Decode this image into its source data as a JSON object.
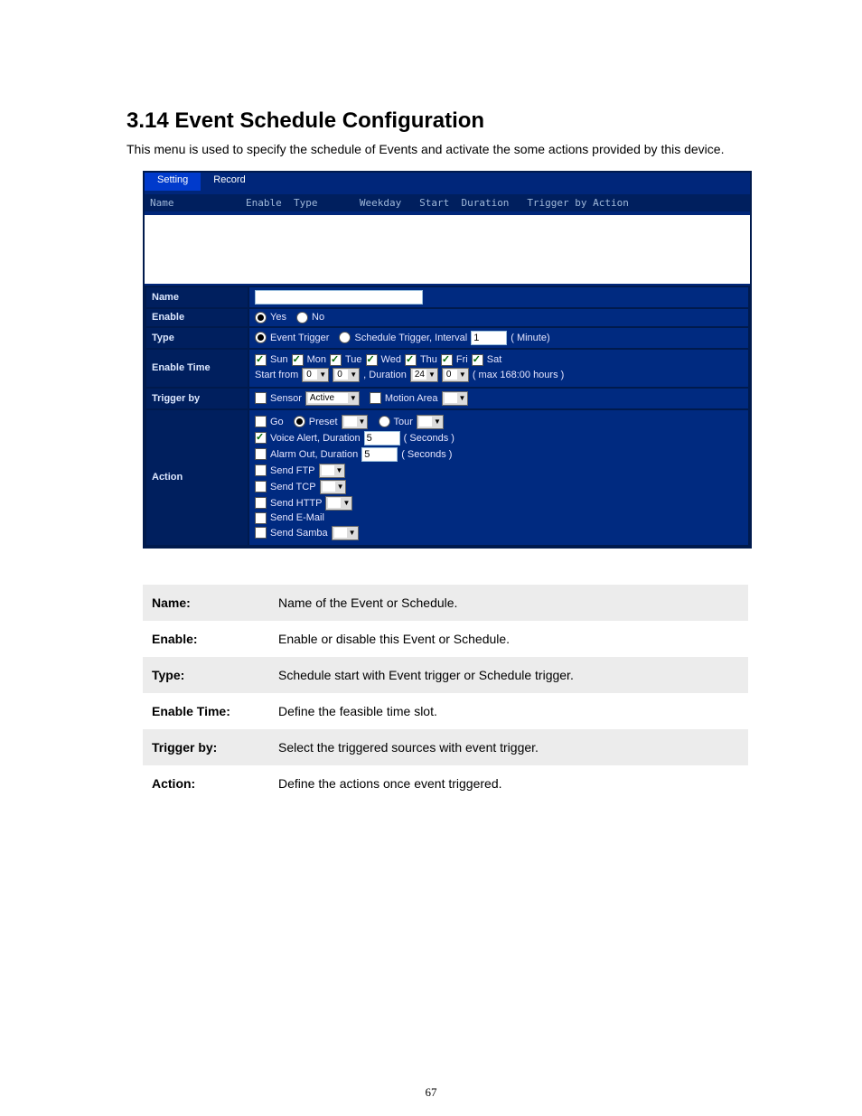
{
  "heading": "3.14 Event Schedule Configuration",
  "intro": "This menu is used to specify the schedule of Events and activate the some actions provided by this device.",
  "page_number": "67",
  "tabs": {
    "setting": "Setting",
    "record": "Record"
  },
  "list_header": {
    "name": "Name",
    "enable": "Enable",
    "type": "Type",
    "weekday": "Weekday",
    "start": "Start",
    "duration": "Duration",
    "trigger": "Trigger by Action"
  },
  "form": {
    "name_label": "Name",
    "name_value": "",
    "enable_label": "Enable",
    "enable_yes": "Yes",
    "enable_no": "No",
    "type_label": "Type",
    "type_event": "Event Trigger",
    "type_sched": "Schedule Trigger, Interval",
    "type_interval": "1",
    "type_unit": "( Minute)",
    "enabletime_label": "Enable Time",
    "days": {
      "sun": "Sun",
      "mon": "Mon",
      "tue": "Tue",
      "wed": "Wed",
      "thu": "Thu",
      "fri": "Fri",
      "sat": "Sat"
    },
    "start_from": "Start from",
    "start_h": "0",
    "start_m": "0",
    "dur_label": ", Duration",
    "dur_h": "24",
    "dur_m": "0",
    "dur_hint": "( max 168:00 hours )",
    "trigger_label": "Trigger by",
    "trigger_sensor": "Sensor",
    "trigger_sensor_val": "Active",
    "trigger_motion": "Motion Area",
    "action_label": "Action",
    "act_go": "Go",
    "act_preset": "Preset",
    "act_tour": "Tour",
    "act_voice": "Voice Alert, Duration",
    "act_voice_val": "5",
    "act_voice_unit": "( Seconds )",
    "act_alarm": "Alarm Out, Duration",
    "act_alarm_val": "5",
    "act_alarm_unit": "( Seconds )",
    "act_ftp": "Send FTP",
    "act_tcp": "Send TCP",
    "act_http": "Send HTTP",
    "act_email": "Send E-Mail",
    "act_samba": "Send Samba"
  },
  "defs": [
    {
      "k": "Name:",
      "v": "Name of the Event or Schedule."
    },
    {
      "k": "Enable:",
      "v": "Enable or disable this Event or Schedule."
    },
    {
      "k": "Type:",
      "v": "Schedule start with Event trigger or Schedule trigger."
    },
    {
      "k": "Enable Time:",
      "v": "Define the feasible time slot."
    },
    {
      "k": "Trigger by:",
      "v": "Select the triggered sources with event trigger."
    },
    {
      "k": "Action:",
      "v": "Define the actions once event triggered."
    }
  ]
}
